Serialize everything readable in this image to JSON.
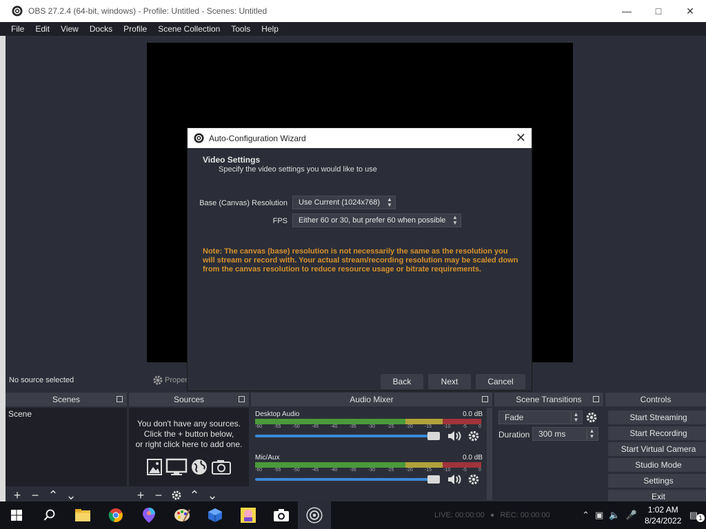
{
  "window": {
    "title": "OBS 27.2.4 (64-bit, windows) - Profile: Untitled - Scenes: Untitled"
  },
  "menu": [
    "File",
    "Edit",
    "View",
    "Docks",
    "Profile",
    "Scene Collection",
    "Tools",
    "Help"
  ],
  "source_bar": {
    "no_source": "No source selected",
    "properties": "Properties"
  },
  "docks": {
    "scenes": {
      "title": "Scenes",
      "items": [
        "Scene"
      ]
    },
    "sources": {
      "title": "Sources",
      "empty_line1": "You don't have any sources.",
      "empty_line2": "Click the + button below,",
      "empty_line3": "or right click here to add one."
    },
    "mixer": {
      "title": "Audio Mixer",
      "ticks": [
        "-60",
        "-55",
        "-50",
        "-45",
        "-40",
        "-35",
        "-30",
        "-25",
        "-20",
        "-15",
        "-10",
        "-5",
        "0"
      ],
      "channels": [
        {
          "name": "Desktop Audio",
          "db": "0.0 dB"
        },
        {
          "name": "Mic/Aux",
          "db": "0.0 dB"
        }
      ]
    },
    "transitions": {
      "title": "Scene Transitions",
      "transition": "Fade",
      "duration_label": "Duration",
      "duration_value": "300 ms"
    },
    "controls": {
      "title": "Controls",
      "buttons": [
        "Start Streaming",
        "Start Recording",
        "Start Virtual Camera",
        "Studio Mode",
        "Settings",
        "Exit"
      ]
    }
  },
  "dialog": {
    "title": "Auto-Configuration Wizard",
    "heading": "Video Settings",
    "subheading": "Specify the video settings you would like to use",
    "resolution_label": "Base (Canvas) Resolution",
    "resolution_value": "Use Current (1024x768)",
    "fps_label": "FPS",
    "fps_value": "Either 60 or 30, but prefer 60 when possible",
    "note": "Note: The canvas (base) resolution is not necessarily the same as the resolution you will stream or record with. Your actual stream/recording resolution may be scaled down from the canvas resolution to reduce resource usage or bitrate requirements.",
    "back": "Back",
    "next": "Next",
    "cancel": "Cancel"
  },
  "status": {
    "live": "LIVE: 00:00:00",
    "rec": "REC: 00:00:00"
  },
  "taskbar": {
    "time": "1:02 AM",
    "date": "8/24/2022",
    "notifications": "1"
  }
}
